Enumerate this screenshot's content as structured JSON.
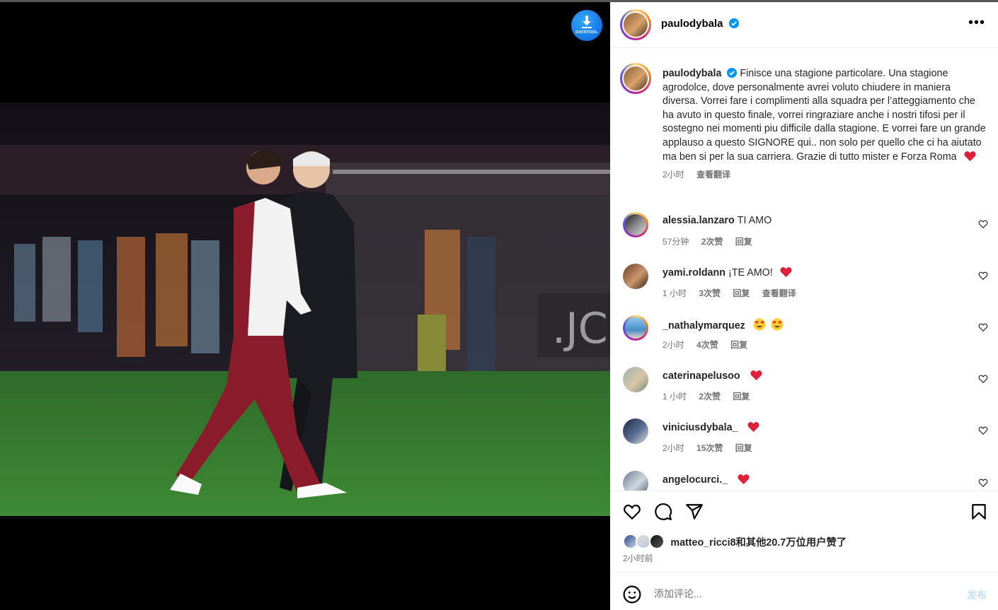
{
  "media": {
    "datatool_label": "DATATOOL"
  },
  "post": {
    "author": "paulodybala",
    "verified": true,
    "caption": "Finisce una stagione particolare. Una stagione agrodolce, dove personalmente avrei voluto chiudere in maniera diversa. Vorrei fare i complimenti alla squadra per l’atteggiamento che ha avuto in questo finale, vorrei ringraziare anche i nostri tifosi per il sostegno nei momenti piu difficile dalla stagione. E vorrei fare un grande applauso a questo SIGNORE qui.. non solo per quello che ci ha aiutato ma ben si per la sua carriera. Grazie di tutto mister e Forza Roma",
    "caption_time": "2小时",
    "translate_label": "查看翻译",
    "likes_text": "matteo_ricci8和其他20.7万位用户赞了",
    "posted_ago": "2小时前",
    "add_comment_placeholder": "添加评论...",
    "post_button": "发布"
  },
  "comments": [
    {
      "user": "alessia.lanzaro",
      "text": "TI AMO",
      "time": "57分钟",
      "likes": "2次赞",
      "reply": "回复",
      "translate": ""
    },
    {
      "user": "yami.roldann",
      "text": "¡TE AMO!",
      "time": "1 小时",
      "likes": "3次赞",
      "reply": "回复",
      "translate": "查看翻译"
    },
    {
      "user": "_nathalymarquez",
      "text": "",
      "time": "2小时",
      "likes": "4次赞",
      "reply": "回复",
      "translate": ""
    },
    {
      "user": "caterinapelusoo",
      "text": "",
      "time": "1 小时",
      "likes": "2次赞",
      "reply": "回复",
      "translate": ""
    },
    {
      "user": "viniciusdybala_",
      "text": "",
      "time": "2小时",
      "likes": "15次赞",
      "reply": "回复",
      "translate": ""
    },
    {
      "user": "angelocurci._",
      "text": "",
      "time": "",
      "likes": "",
      "reply": "",
      "translate": ""
    }
  ],
  "colors": {
    "accent_blue": "#0095f6",
    "heart_red": "#ff3040",
    "muted_text": "#737373",
    "jersey_maroon": "#8b1c2b"
  }
}
